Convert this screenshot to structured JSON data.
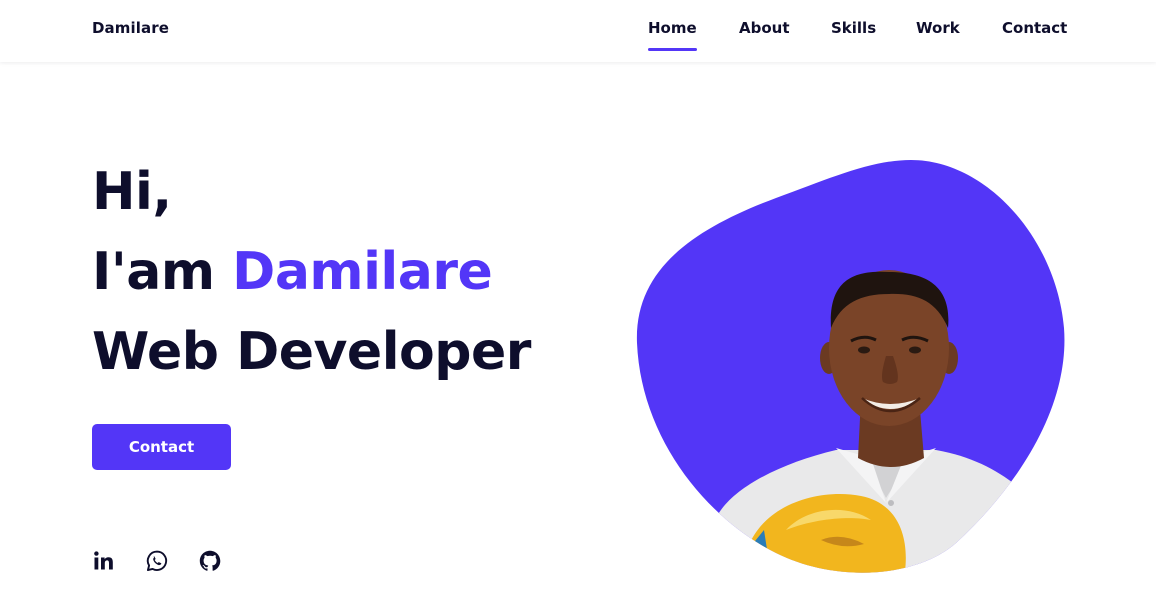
{
  "header": {
    "logo": "Damilare",
    "nav": [
      {
        "label": "Home",
        "active": true
      },
      {
        "label": "About",
        "active": false
      },
      {
        "label": "Skills",
        "active": false
      },
      {
        "label": "Work",
        "active": false
      },
      {
        "label": "Contact",
        "active": false
      }
    ]
  },
  "hero": {
    "greeting": "Hi,",
    "intro_prefix": "I'am ",
    "name": "Damilare",
    "role": "Web Developer",
    "contact_button": "Contact"
  },
  "social": {
    "icons": [
      "linkedin-icon",
      "whatsapp-icon",
      "github-icon"
    ]
  },
  "colors": {
    "accent": "#5336f7",
    "text": "#0e0e2c",
    "background": "#ffffff"
  }
}
